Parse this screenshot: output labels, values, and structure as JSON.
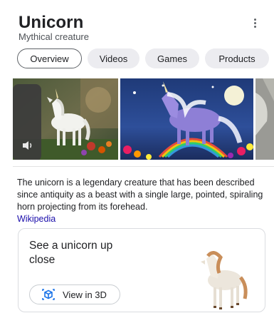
{
  "header": {
    "title": "Unicorn",
    "subtitle": "Mythical creature"
  },
  "tabs": [
    {
      "label": "Overview",
      "active": true
    },
    {
      "label": "Videos",
      "active": false
    },
    {
      "label": "Games",
      "active": false
    },
    {
      "label": "Products",
      "active": false
    }
  ],
  "gallery": {
    "images": [
      {
        "icon": "white-unicorn-image"
      },
      {
        "icon": "fantasy-unicorn-rainbow-image"
      },
      {
        "icon": "unicorn-partial-image"
      }
    ],
    "sound_icon": "volume-icon"
  },
  "description": {
    "text": "The unicorn is a legendary creature that has been described since antiquity as a beast with a single large, pointed, spiraling horn projecting from its forehead.",
    "source_link": "Wikipedia"
  },
  "card_3d": {
    "title": "See a unicorn up close",
    "button_label": "View in 3D",
    "button_icon": "3d-cube-icon"
  },
  "colors": {
    "link": "#1a0dab",
    "chip_bg": "#ececf0",
    "chip_active_border": "#5f6368",
    "accent_3d": "#1a73e8"
  }
}
